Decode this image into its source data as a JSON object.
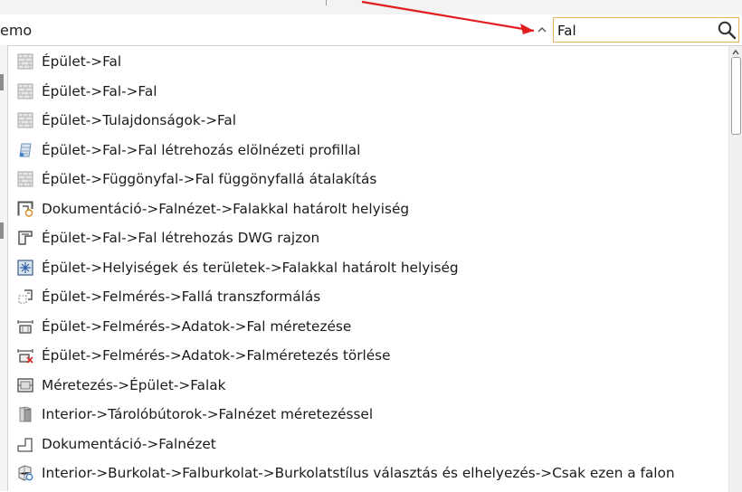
{
  "header": {
    "partial_label": "emo",
    "search_value": "Fal"
  },
  "icons": {
    "collapse": "chevron-up-icon",
    "search": "search-icon"
  },
  "colors": {
    "annotation_arrow": "#e01e1e",
    "search_border": "#e9b25c"
  },
  "results": [
    {
      "label": "Épület->Fal",
      "icon": "wall-icon"
    },
    {
      "label": "Épület->Fal->Fal",
      "icon": "wall-icon"
    },
    {
      "label": "Épület->Tulajdonságok->Fal",
      "icon": "wall-icon"
    },
    {
      "label": "Épület->Fal->Fal létrehozás elölnézeti profillal",
      "icon": "wall-profile-icon"
    },
    {
      "label": "Épület->Függönyfal->Fal függönyfallá átalakítás",
      "icon": "wall-icon"
    },
    {
      "label": "Dokumentáció->Falnézet->Falakkal határolt helyiség",
      "icon": "room-bounded-icon"
    },
    {
      "label": "Épület->Fal->Fal létrehozás DWG rajzon",
      "icon": "dwg-wall-icon"
    },
    {
      "label": "Épület->Helyiségek és területek->Falakkal határolt helyiség",
      "icon": "room-area-icon"
    },
    {
      "label": "Épület->Felmérés->Fallá transzformálás",
      "icon": "survey-transform-icon"
    },
    {
      "label": "Épület->Felmérés->Adatok->Fal méretezése",
      "icon": "survey-dimension-icon"
    },
    {
      "label": "Épület->Felmérés->Adatok->Falméretezés törlése",
      "icon": "survey-dimension-delete-icon"
    },
    {
      "label": "Méretezés->Épület->Falak",
      "icon": "dimension-walls-icon"
    },
    {
      "label": "Interior->Tárolóbútorok->Falnézet méretezéssel",
      "icon": "cabinet-icon"
    },
    {
      "label": "Dokumentáció->Falnézet",
      "icon": "wall-view-icon"
    },
    {
      "label": "Interior->Burkolat->Falburkolat->Burkolatstílus választás és elhelyezés->Csak ezen a falon",
      "icon": "cladding-icon"
    }
  ]
}
